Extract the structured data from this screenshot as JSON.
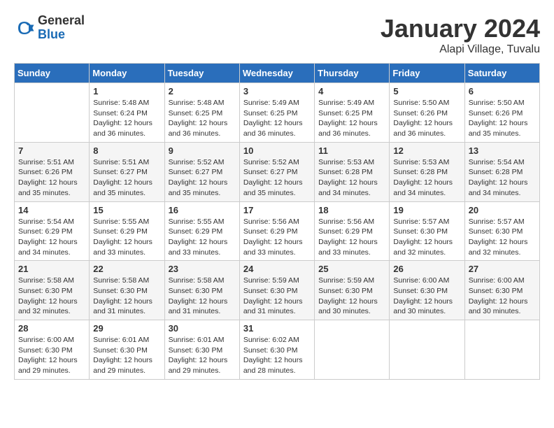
{
  "logo": {
    "general": "General",
    "blue": "Blue"
  },
  "title": "January 2024",
  "subtitle": "Alapi Village, Tuvalu",
  "days_of_week": [
    "Sunday",
    "Monday",
    "Tuesday",
    "Wednesday",
    "Thursday",
    "Friday",
    "Saturday"
  ],
  "weeks": [
    [
      {
        "day": "",
        "info": ""
      },
      {
        "day": "1",
        "info": "Sunrise: 5:48 AM\nSunset: 6:24 PM\nDaylight: 12 hours\nand 36 minutes."
      },
      {
        "day": "2",
        "info": "Sunrise: 5:48 AM\nSunset: 6:25 PM\nDaylight: 12 hours\nand 36 minutes."
      },
      {
        "day": "3",
        "info": "Sunrise: 5:49 AM\nSunset: 6:25 PM\nDaylight: 12 hours\nand 36 minutes."
      },
      {
        "day": "4",
        "info": "Sunrise: 5:49 AM\nSunset: 6:25 PM\nDaylight: 12 hours\nand 36 minutes."
      },
      {
        "day": "5",
        "info": "Sunrise: 5:50 AM\nSunset: 6:26 PM\nDaylight: 12 hours\nand 36 minutes."
      },
      {
        "day": "6",
        "info": "Sunrise: 5:50 AM\nSunset: 6:26 PM\nDaylight: 12 hours\nand 35 minutes."
      }
    ],
    [
      {
        "day": "7",
        "info": "Sunrise: 5:51 AM\nSunset: 6:26 PM\nDaylight: 12 hours\nand 35 minutes."
      },
      {
        "day": "8",
        "info": "Sunrise: 5:51 AM\nSunset: 6:27 PM\nDaylight: 12 hours\nand 35 minutes."
      },
      {
        "day": "9",
        "info": "Sunrise: 5:52 AM\nSunset: 6:27 PM\nDaylight: 12 hours\nand 35 minutes."
      },
      {
        "day": "10",
        "info": "Sunrise: 5:52 AM\nSunset: 6:27 PM\nDaylight: 12 hours\nand 35 minutes."
      },
      {
        "day": "11",
        "info": "Sunrise: 5:53 AM\nSunset: 6:28 PM\nDaylight: 12 hours\nand 34 minutes."
      },
      {
        "day": "12",
        "info": "Sunrise: 5:53 AM\nSunset: 6:28 PM\nDaylight: 12 hours\nand 34 minutes."
      },
      {
        "day": "13",
        "info": "Sunrise: 5:54 AM\nSunset: 6:28 PM\nDaylight: 12 hours\nand 34 minutes."
      }
    ],
    [
      {
        "day": "14",
        "info": "Sunrise: 5:54 AM\nSunset: 6:29 PM\nDaylight: 12 hours\nand 34 minutes."
      },
      {
        "day": "15",
        "info": "Sunrise: 5:55 AM\nSunset: 6:29 PM\nDaylight: 12 hours\nand 33 minutes."
      },
      {
        "day": "16",
        "info": "Sunrise: 5:55 AM\nSunset: 6:29 PM\nDaylight: 12 hours\nand 33 minutes."
      },
      {
        "day": "17",
        "info": "Sunrise: 5:56 AM\nSunset: 6:29 PM\nDaylight: 12 hours\nand 33 minutes."
      },
      {
        "day": "18",
        "info": "Sunrise: 5:56 AM\nSunset: 6:29 PM\nDaylight: 12 hours\nand 33 minutes."
      },
      {
        "day": "19",
        "info": "Sunrise: 5:57 AM\nSunset: 6:30 PM\nDaylight: 12 hours\nand 32 minutes."
      },
      {
        "day": "20",
        "info": "Sunrise: 5:57 AM\nSunset: 6:30 PM\nDaylight: 12 hours\nand 32 minutes."
      }
    ],
    [
      {
        "day": "21",
        "info": "Sunrise: 5:58 AM\nSunset: 6:30 PM\nDaylight: 12 hours\nand 32 minutes."
      },
      {
        "day": "22",
        "info": "Sunrise: 5:58 AM\nSunset: 6:30 PM\nDaylight: 12 hours\nand 31 minutes."
      },
      {
        "day": "23",
        "info": "Sunrise: 5:58 AM\nSunset: 6:30 PM\nDaylight: 12 hours\nand 31 minutes."
      },
      {
        "day": "24",
        "info": "Sunrise: 5:59 AM\nSunset: 6:30 PM\nDaylight: 12 hours\nand 31 minutes."
      },
      {
        "day": "25",
        "info": "Sunrise: 5:59 AM\nSunset: 6:30 PM\nDaylight: 12 hours\nand 30 minutes."
      },
      {
        "day": "26",
        "info": "Sunrise: 6:00 AM\nSunset: 6:30 PM\nDaylight: 12 hours\nand 30 minutes."
      },
      {
        "day": "27",
        "info": "Sunrise: 6:00 AM\nSunset: 6:30 PM\nDaylight: 12 hours\nand 30 minutes."
      }
    ],
    [
      {
        "day": "28",
        "info": "Sunrise: 6:00 AM\nSunset: 6:30 PM\nDaylight: 12 hours\nand 29 minutes."
      },
      {
        "day": "29",
        "info": "Sunrise: 6:01 AM\nSunset: 6:30 PM\nDaylight: 12 hours\nand 29 minutes."
      },
      {
        "day": "30",
        "info": "Sunrise: 6:01 AM\nSunset: 6:30 PM\nDaylight: 12 hours\nand 29 minutes."
      },
      {
        "day": "31",
        "info": "Sunrise: 6:02 AM\nSunset: 6:30 PM\nDaylight: 12 hours\nand 28 minutes."
      },
      {
        "day": "",
        "info": ""
      },
      {
        "day": "",
        "info": ""
      },
      {
        "day": "",
        "info": ""
      }
    ]
  ]
}
